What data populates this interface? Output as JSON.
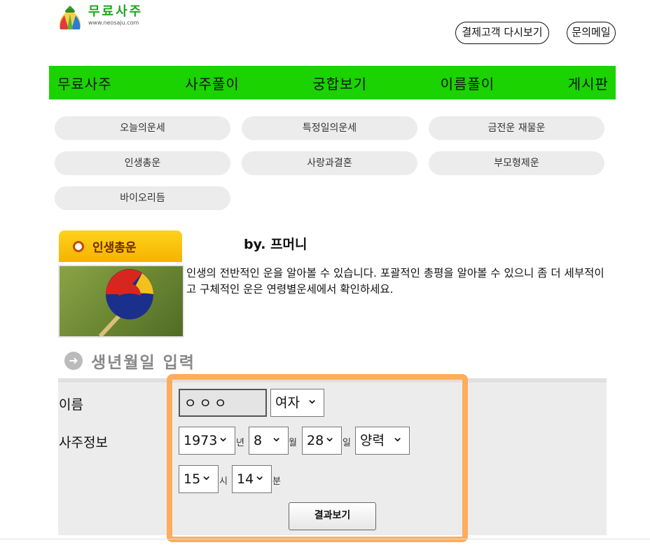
{
  "header": {
    "logo_title": "무료사주",
    "logo_url": "www.neosaju.com",
    "reorder_link": "결제고객 다시보기",
    "contact_link": "문의메일"
  },
  "nav": {
    "items": [
      "무료사주",
      "사주풀이",
      "궁합보기",
      "이름풀이",
      "게시판"
    ]
  },
  "submenu": {
    "items": [
      "오늘의운세",
      "특정일의운세",
      "금전운 재물운",
      "인생총운",
      "사랑과결혼",
      "부모형제운",
      "바이오리듬"
    ]
  },
  "section": {
    "tab_label": "인생총운",
    "byline": "by. 프머니",
    "description": "인생의 전반적인 운을 알아볼 수 있습니다. 포괄적인 총평을 알아볼 수 있으니 좀 더 세부적이고 구체적인 운은 연령별운세에서 확인하세요."
  },
  "form": {
    "heading": "생년월일 입력",
    "name_label": "이름",
    "info_label": "사주정보",
    "name_value": "ㅇㅇㅇ",
    "gender": "여자",
    "year": "1973",
    "year_unit": "년",
    "month": "8",
    "month_unit": "월",
    "day": "28",
    "day_unit": "일",
    "calendar": "양력",
    "hour": "15",
    "hour_unit": "시",
    "minute": "14",
    "minute_unit": "분",
    "submit": "결과보기"
  },
  "colors": {
    "nav_green": "#1ad300",
    "highlight_orange": "#ffac5c",
    "tab_yellow": "#ffc800"
  }
}
